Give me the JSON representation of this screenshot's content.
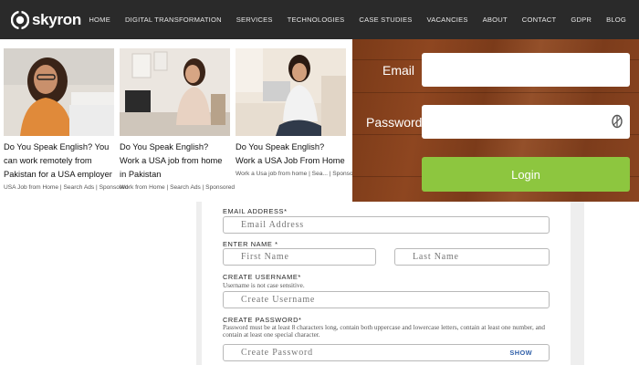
{
  "brand": {
    "name": "skyron"
  },
  "nav": [
    "HOME",
    "DIGITAL TRANSFORMATION",
    "SERVICES",
    "TECHNOLOGIES",
    "CASE STUDIES",
    "VACANCIES",
    "ABOUT",
    "CONTACT",
    "GDPR",
    "BLOG"
  ],
  "ads": [
    {
      "title": "Do You Speak English? You can work remotely from Pakistan for a USA employer",
      "source": "USA Job from Home | Search Ads | Sponsored"
    },
    {
      "title": "Do You Speak English? Work a USA job from home in Pakistan",
      "source": "Work from Home | Search Ads | Sponsored"
    },
    {
      "title": "Do You Speak English? Work a USA Job From Home",
      "source": "Work a Usa job from home | Sea... | Sponsored"
    }
  ],
  "login": {
    "email_label": "Email",
    "password_label": "Password",
    "button_label": "Login",
    "button_color": "#8dc63f"
  },
  "form": {
    "email_label": "EMAIL ADDRESS*",
    "email_placeholder": "Email Address",
    "name_label": "ENTER NAME *",
    "first_placeholder": "First Name",
    "last_placeholder": "Last Name",
    "username_label": "CREATE USERNAME*",
    "username_note": "Username is not case sensitive.",
    "username_placeholder": "Create Username",
    "password_label": "CREATE PASSWORD*",
    "password_note": "Password must be at least 8 characters long, contain both uppercase and lowercase letters, contain at least one number, and contain at least one special character.",
    "password_placeholder": "Create Password",
    "show_label": "SHOW"
  }
}
